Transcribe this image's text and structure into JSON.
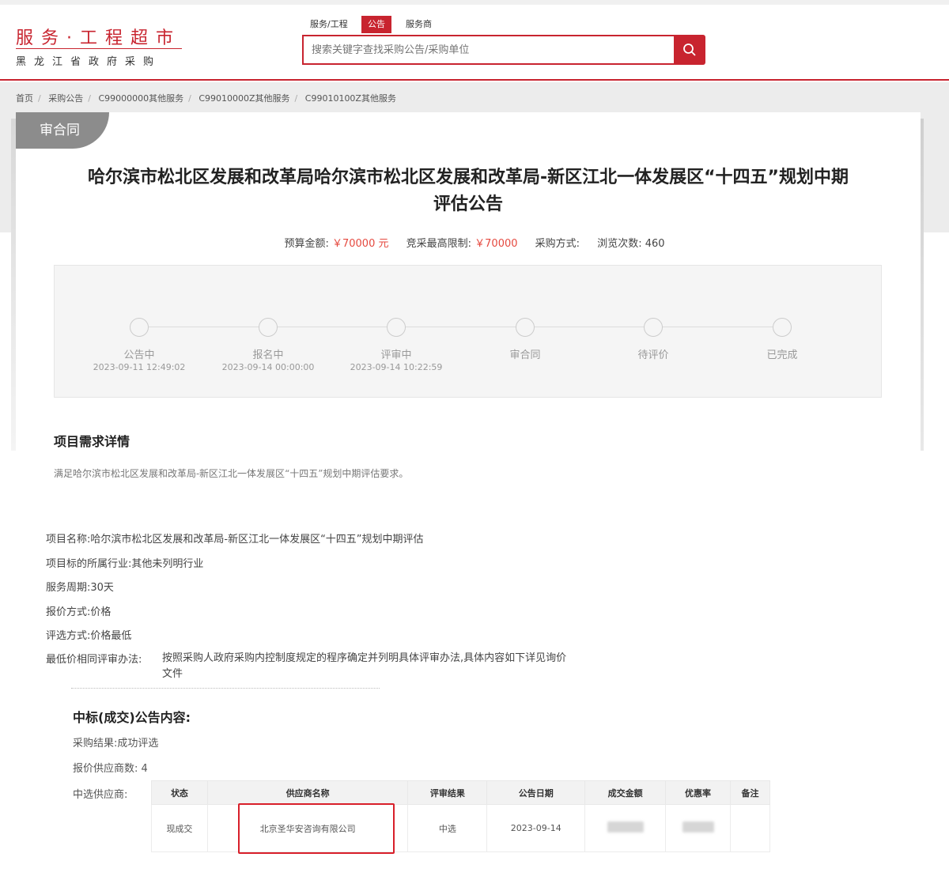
{
  "logo": {
    "main": "服务·工程超市",
    "sub": "黑龙江省政府采购"
  },
  "search_tabs": [
    "服务/工程",
    "公告",
    "服务商"
  ],
  "search": {
    "placeholder": "搜索关键字查找采购公告/采购单位"
  },
  "breadcrumb": [
    "首页",
    "采购公告",
    "C99000000其他服务",
    "C99010000Z其他服务",
    "C99010100Z其他服务"
  ],
  "status_badge": "审合同",
  "title": "哈尔滨市松北区发展和改革局哈尔滨市松北区发展和改革局-新区江北一体发展区“十四五”规划中期评估公告",
  "meta": {
    "budget_label": "预算金额:",
    "budget_value": "￥70000 元",
    "max_label": "竞采最高限制:",
    "max_value": "￥70000",
    "method_label": "采购方式:",
    "views_label": "浏览次数:",
    "views_value": "460"
  },
  "progress_steps": [
    {
      "label": "公告中",
      "date": "2023-09-11 12:49:02"
    },
    {
      "label": "报名中",
      "date": "2023-09-14 00:00:00"
    },
    {
      "label": "评审中",
      "date": "2023-09-14 10:22:59"
    },
    {
      "label": "审合同",
      "date": ""
    },
    {
      "label": "待评价",
      "date": ""
    },
    {
      "label": "已完成",
      "date": ""
    }
  ],
  "requirement": {
    "heading": "项目需求详情",
    "desc": "满足哈尔滨市松北区发展和改革局-新区江北一体发展区“十四五”规划中期评估要求。"
  },
  "info": {
    "name": "项目名称:哈尔滨市松北区发展和改革局-新区江北一体发展区“十四五”规划中期评估",
    "industry": "项目标的所属行业:其他未列明行业",
    "period": "服务周期:30天",
    "quote_method": "报价方式:价格",
    "eval_method": "评选方式:价格最低",
    "lowest_label": "最低价相同评审办法:",
    "lowest_text": "按照采购人政府采购内控制度规定的程序确定并列明具体评审办法,具体内容如下详见询价文件"
  },
  "award": {
    "heading": "中标(成交)公告内容:",
    "result": "采购结果:成功评选",
    "supplier_count": "报价供应商数: 4",
    "selected_label": "中选供应商:",
    "columns": [
      "状态",
      "供应商名称",
      "评审结果",
      "公告日期",
      "成交金额",
      "优惠率",
      "备注"
    ],
    "row": {
      "status": "现成交",
      "supplier": "北京圣华安咨询有限公司",
      "result": "中选",
      "date": "2023-09-14",
      "note": ""
    }
  },
  "colors": {
    "brand": "#c8242f",
    "price": "#e5493f",
    "badge": "#8c8c8c"
  }
}
